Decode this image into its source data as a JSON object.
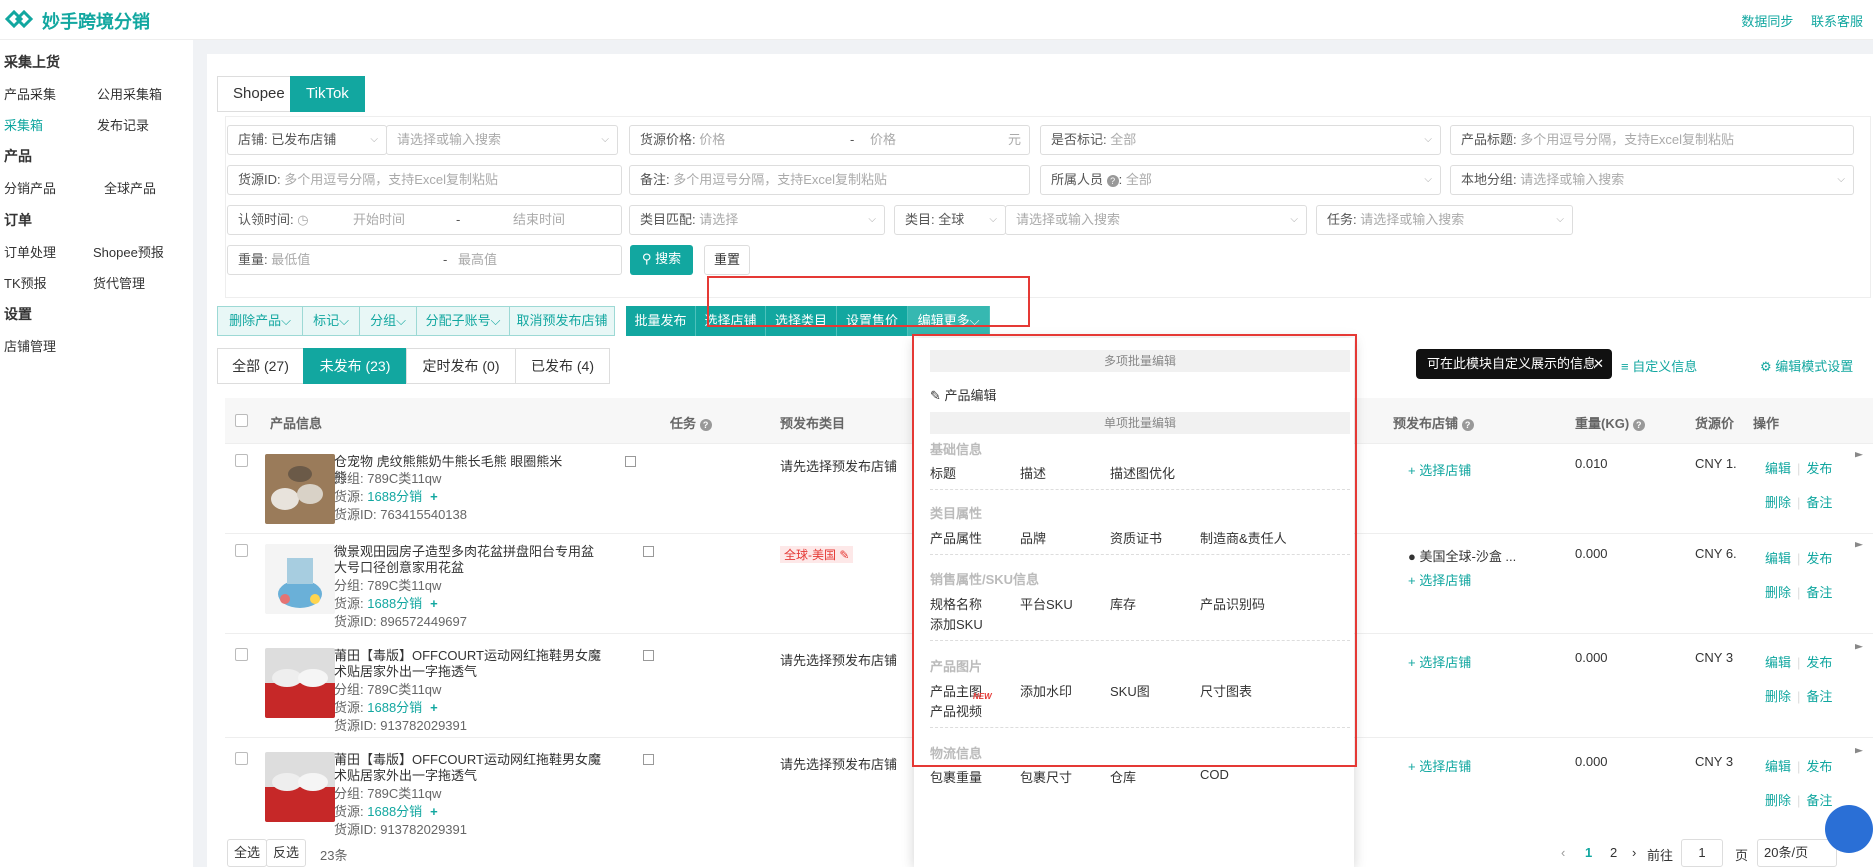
{
  "app": {
    "title": "妙手跨境分销",
    "top_links": [
      "数据同步",
      "联系客服"
    ]
  },
  "sidebar": {
    "groups": [
      {
        "label": "采集上货",
        "items": [
          "产品采集",
          "公用采集箱",
          "采集箱",
          "发布记录"
        ]
      },
      {
        "label": "产品",
        "items": [
          "分销产品",
          "全球产品"
        ]
      },
      {
        "label": "订单",
        "items": [
          "订单处理",
          "Shopee预报",
          "TK预报",
          "货代管理"
        ]
      },
      {
        "label": "设置",
        "items": [
          "店铺管理"
        ]
      }
    ],
    "active": "采集箱"
  },
  "platform_tabs": [
    "Shopee",
    "TikTok"
  ],
  "platform_selected": "TikTok",
  "filters": {
    "store_label": "店铺:",
    "store_value": "已发布店铺",
    "store_search_ph": "请选择或输入搜索",
    "price_label": "货源价格:",
    "price_min_ph": "价格",
    "price_max_ph": "价格",
    "price_unit": "元",
    "mark_label": "是否标记:",
    "mark_value": "全部",
    "title_label": "产品标题:",
    "title_ph": "多个用逗号分隔，支持Excel复制粘贴",
    "source_id_label": "货源ID:",
    "source_id_ph": "多个用逗号分隔，支持Excel复制粘贴",
    "remark_label": "备注:",
    "remark_ph": "多个用逗号分隔，支持Excel复制粘贴",
    "member_label": "所属人员",
    "member_value": "全部",
    "local_group_label": "本地分组:",
    "local_group_ph": "请选择或输入搜索",
    "claim_time_label": "认领时间:",
    "start_ph": "开始时间",
    "end_ph": "结束时间",
    "cat_match_label": "类目匹配:",
    "cat_match_ph": "请选择",
    "category_label": "类目:",
    "category_value": "全球",
    "category_search_ph": "请选择或输入搜索",
    "task_label": "任务:",
    "task_ph": "请选择或输入搜索",
    "weight_label": "重量:",
    "weight_min_ph": "最低值",
    "weight_max_ph": "最高值",
    "dash": "-",
    "search_btn": "搜索",
    "reset_btn": "重置"
  },
  "ops_light": [
    "删除产品",
    "标记",
    "分组",
    "分配子账号",
    "取消预发布店铺"
  ],
  "ops_dark": [
    "批量发布",
    "选择店铺",
    "选择类目",
    "设置售价",
    "编辑更多"
  ],
  "status_tabs": [
    "全部 (27)",
    "未发布 (23)",
    "定时发布 (0)",
    "已发布 (4)"
  ],
  "status_selected": "未发布 (23)",
  "tooltip": "可在此模块自定义展示的信息",
  "right_links": [
    "自定义信息",
    "编辑模式设置"
  ],
  "table_headers": {
    "info": "产品信息",
    "task": "任务",
    "cat": "预发布类目",
    "store": "预发布店铺",
    "weight": "重量(KG)",
    "price": "货源价",
    "op": "操作"
  },
  "rows": [
    {
      "title": "仓宠物 虎纹熊熊奶牛熊长毛熊 眼圈熊米熊",
      "group": "分组: 789C类11qw",
      "src_label": "货源:",
      "src": "1688分销",
      "sid": "货源ID: 763415540138",
      "cat": "请先选择预发布店铺",
      "store": "",
      "store_link": "选择店铺",
      "weight": "0.010",
      "price": "CNY 1.",
      "ops": [
        "编辑",
        "发布",
        "删除",
        "备注"
      ]
    },
    {
      "title": "微景观田园房子造型多肉花盆拼盘阳台专用盆大号口径创意家用花盆",
      "group": "分组: 789C类11qw",
      "src_label": "货源:",
      "src": "1688分销",
      "sid": "货源ID: 896572449697",
      "cat": "全球-美国",
      "store": "美国全球-沙盒 ...",
      "store_link": "选择店铺",
      "weight": "0.000",
      "price": "CNY 6.",
      "ops": [
        "编辑",
        "发布",
        "删除",
        "备注"
      ]
    },
    {
      "title": "莆田【毒版】OFFCOURT运动网红拖鞋男女魔术贴居家外出一字拖透气",
      "group": "分组: 789C类11qw",
      "src_label": "货源:",
      "src": "1688分销",
      "sid": "货源ID: 913782029391",
      "cat": "请先选择预发布店铺",
      "store": "",
      "store_link": "选择店铺",
      "weight": "0.000",
      "price": "CNY 3",
      "ops": [
        "编辑",
        "发布",
        "删除",
        "备注"
      ]
    },
    {
      "title": "莆田【毒版】OFFCOURT运动网红拖鞋男女魔术贴居家外出一字拖透气",
      "group": "分组: 789C类11qw",
      "src_label": "货源:",
      "src": "1688分销",
      "sid": "货源ID: 913782029391",
      "cat": "请先选择预发布店铺",
      "store": "",
      "store_link": "选择店铺",
      "weight": "0.000",
      "price": "CNY 3",
      "ops": [
        "编辑",
        "发布",
        "删除",
        "备注"
      ]
    }
  ],
  "dropdown": {
    "multi_header": "多项批量编辑",
    "product_edit": "产品编辑",
    "single_header": "单项批量编辑",
    "sections": [
      {
        "title": "基础信息",
        "items": [
          "标题",
          "描述",
          "描述图优化"
        ]
      },
      {
        "title": "类目属性",
        "items": [
          "产品属性",
          "品牌",
          "资质证书",
          "制造商&责任人"
        ]
      },
      {
        "title": "销售属性/SKU信息",
        "items": [
          "规格名称",
          "平台SKU",
          "库存",
          "产品识别码",
          "添加SKU"
        ]
      },
      {
        "title": "产品图片",
        "items": [
          "产品主图",
          "添加水印",
          "SKU图",
          "尺寸图表",
          "产品视频"
        ]
      },
      {
        "title": "物流信息",
        "items": [
          "包裹重量",
          "包裹尺寸",
          "仓库",
          "COD"
        ]
      }
    ],
    "new_badge": "NEW"
  },
  "footer": {
    "select_all": "全选",
    "invert": "反选",
    "count": "23条",
    "pages": [
      "1",
      "2"
    ],
    "goto": "前往",
    "page_input": "1",
    "page_unit": "页",
    "page_size": "20条/页"
  }
}
